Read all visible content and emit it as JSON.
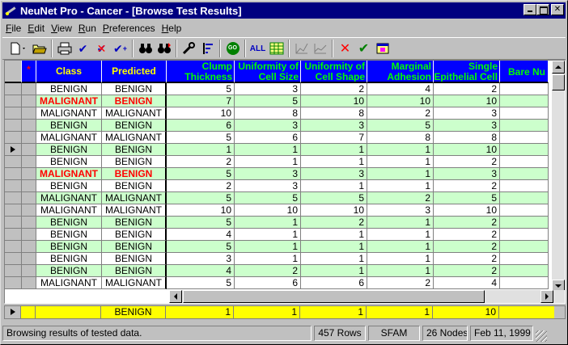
{
  "window": {
    "title": "NeuNet Pro - Cancer - [Browse Test Results]"
  },
  "menu": [
    "File",
    "Edit",
    "View",
    "Run",
    "Preferences",
    "Help"
  ],
  "toolbar": {
    "all_label": "ALL",
    "go_label": "GO"
  },
  "grid": {
    "star": "*",
    "columns": [
      "Class",
      "Predicted",
      "Clump Thickness",
      "Uniformity of Cell Size",
      "Uniformity of Cell Shape",
      "Marginal Adhesion",
      "Single Epithelial Cell",
      "Bare Nu"
    ],
    "rows": [
      [
        "BENIGN",
        "BENIGN",
        "5",
        "3",
        "2",
        "4",
        "2"
      ],
      [
        "MALIGNANT",
        "BENIGN",
        "7",
        "5",
        "10",
        "10",
        "10"
      ],
      [
        "MALIGNANT",
        "MALIGNANT",
        "10",
        "8",
        "8",
        "2",
        "3"
      ],
      [
        "BENIGN",
        "BENIGN",
        "6",
        "3",
        "3",
        "5",
        "3"
      ],
      [
        "MALIGNANT",
        "MALIGNANT",
        "5",
        "6",
        "7",
        "8",
        "8"
      ],
      [
        "BENIGN",
        "BENIGN",
        "1",
        "1",
        "1",
        "1",
        "10"
      ],
      [
        "BENIGN",
        "BENIGN",
        "2",
        "1",
        "1",
        "1",
        "2"
      ],
      [
        "MALIGNANT",
        "BENIGN",
        "5",
        "3",
        "3",
        "1",
        "3"
      ],
      [
        "BENIGN",
        "BENIGN",
        "2",
        "3",
        "1",
        "1",
        "2"
      ],
      [
        "MALIGNANT",
        "MALIGNANT",
        "5",
        "5",
        "5",
        "2",
        "5"
      ],
      [
        "MALIGNANT",
        "MALIGNANT",
        "10",
        "10",
        "10",
        "3",
        "10"
      ],
      [
        "BENIGN",
        "BENIGN",
        "5",
        "1",
        "2",
        "1",
        "2"
      ],
      [
        "BENIGN",
        "BENIGN",
        "4",
        "1",
        "1",
        "1",
        "2"
      ],
      [
        "BENIGN",
        "BENIGN",
        "5",
        "1",
        "1",
        "1",
        "2"
      ],
      [
        "BENIGN",
        "BENIGN",
        "3",
        "1",
        "1",
        "1",
        "2"
      ],
      [
        "BENIGN",
        "BENIGN",
        "4",
        "2",
        "1",
        "1",
        "2"
      ],
      [
        "MALIGNANT",
        "MALIGNANT",
        "5",
        "6",
        "6",
        "2",
        "4"
      ]
    ],
    "misclassified_rows": [
      1,
      7
    ],
    "current_row": 5
  },
  "footer_row": {
    "predicted": "BENIGN",
    "values": [
      "1",
      "1",
      "1",
      "1",
      "10"
    ]
  },
  "status": {
    "message": "Browsing results of tested data.",
    "rows": "457 Rows",
    "model": "SFAM",
    "nodes": "26 Nodes",
    "date": "Feb 11, 1999"
  },
  "colors": {
    "header_bg": "#0000ff",
    "header_text_yellow": "#ffff00",
    "header_text_green": "#00ff00",
    "row_green": "#ccffcc",
    "footer_yellow": "#ffff00",
    "malignant_red": "#ff0000"
  }
}
